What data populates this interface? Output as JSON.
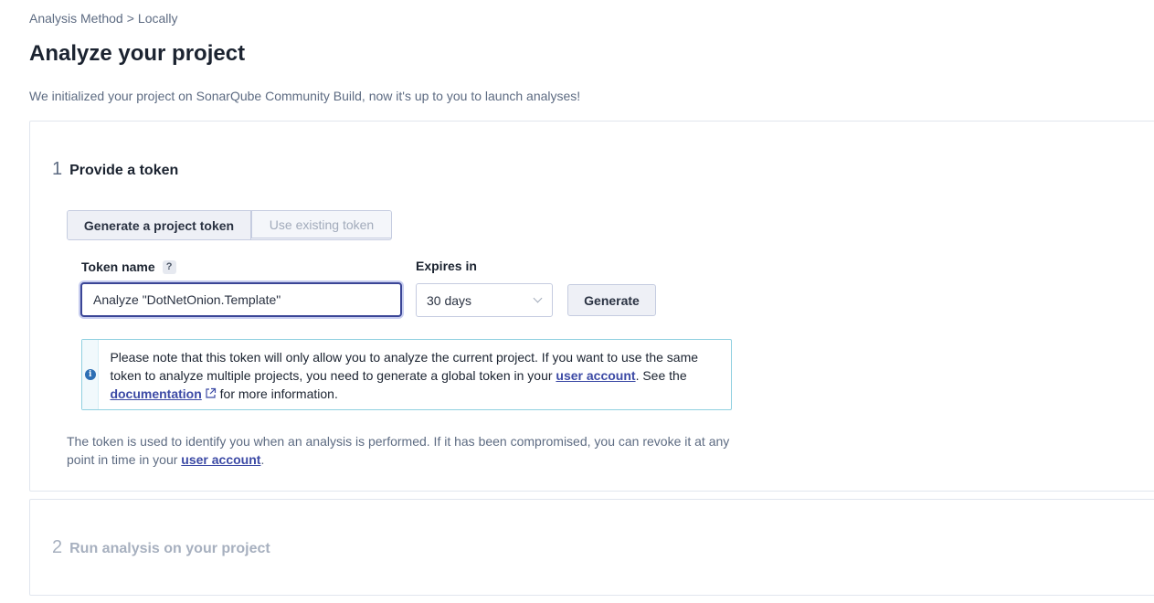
{
  "breadcrumb": {
    "parent": "Analysis Method",
    "separator": ">",
    "current": "Locally"
  },
  "page": {
    "title": "Analyze your project",
    "subtitle": "We initialized your project on SonarQube Community Build, now it's up to you to launch analyses!"
  },
  "step1": {
    "number": "1",
    "title": "Provide a token",
    "toggle": {
      "generate_label": "Generate a project token",
      "existing_label": "Use existing token"
    },
    "token_name_label": "Token name",
    "help_label": "?",
    "token_name_value": "Analyze \"DotNetOnion.Template\"",
    "expires_label": "Expires in",
    "expires_value": "30 days",
    "generate_button": "Generate",
    "info": {
      "text1": "Please note that this token will only allow you to analyze the current project. If you want to use the same token to analyze multiple projects, you need to generate a global token in your ",
      "link_user_account": "user account",
      "text2": ". See the ",
      "link_documentation": "documentation",
      "text3": " for more information."
    },
    "note": {
      "text1": "The token is used to identify you when an analysis is performed. If it has been compromised, you can revoke it at any point in time in your ",
      "link": "user account",
      "text2": "."
    }
  },
  "step2": {
    "number": "2",
    "title": "Run analysis on your project"
  },
  "colors": {
    "accent": "#3c4aa5",
    "info_border": "#8fd0e0",
    "text_muted": "#5d6b82"
  },
  "icons": {
    "help": "question-mark-icon",
    "info": "info-circle-icon",
    "external": "external-link-icon",
    "dropdown": "chevron-down-icon"
  }
}
